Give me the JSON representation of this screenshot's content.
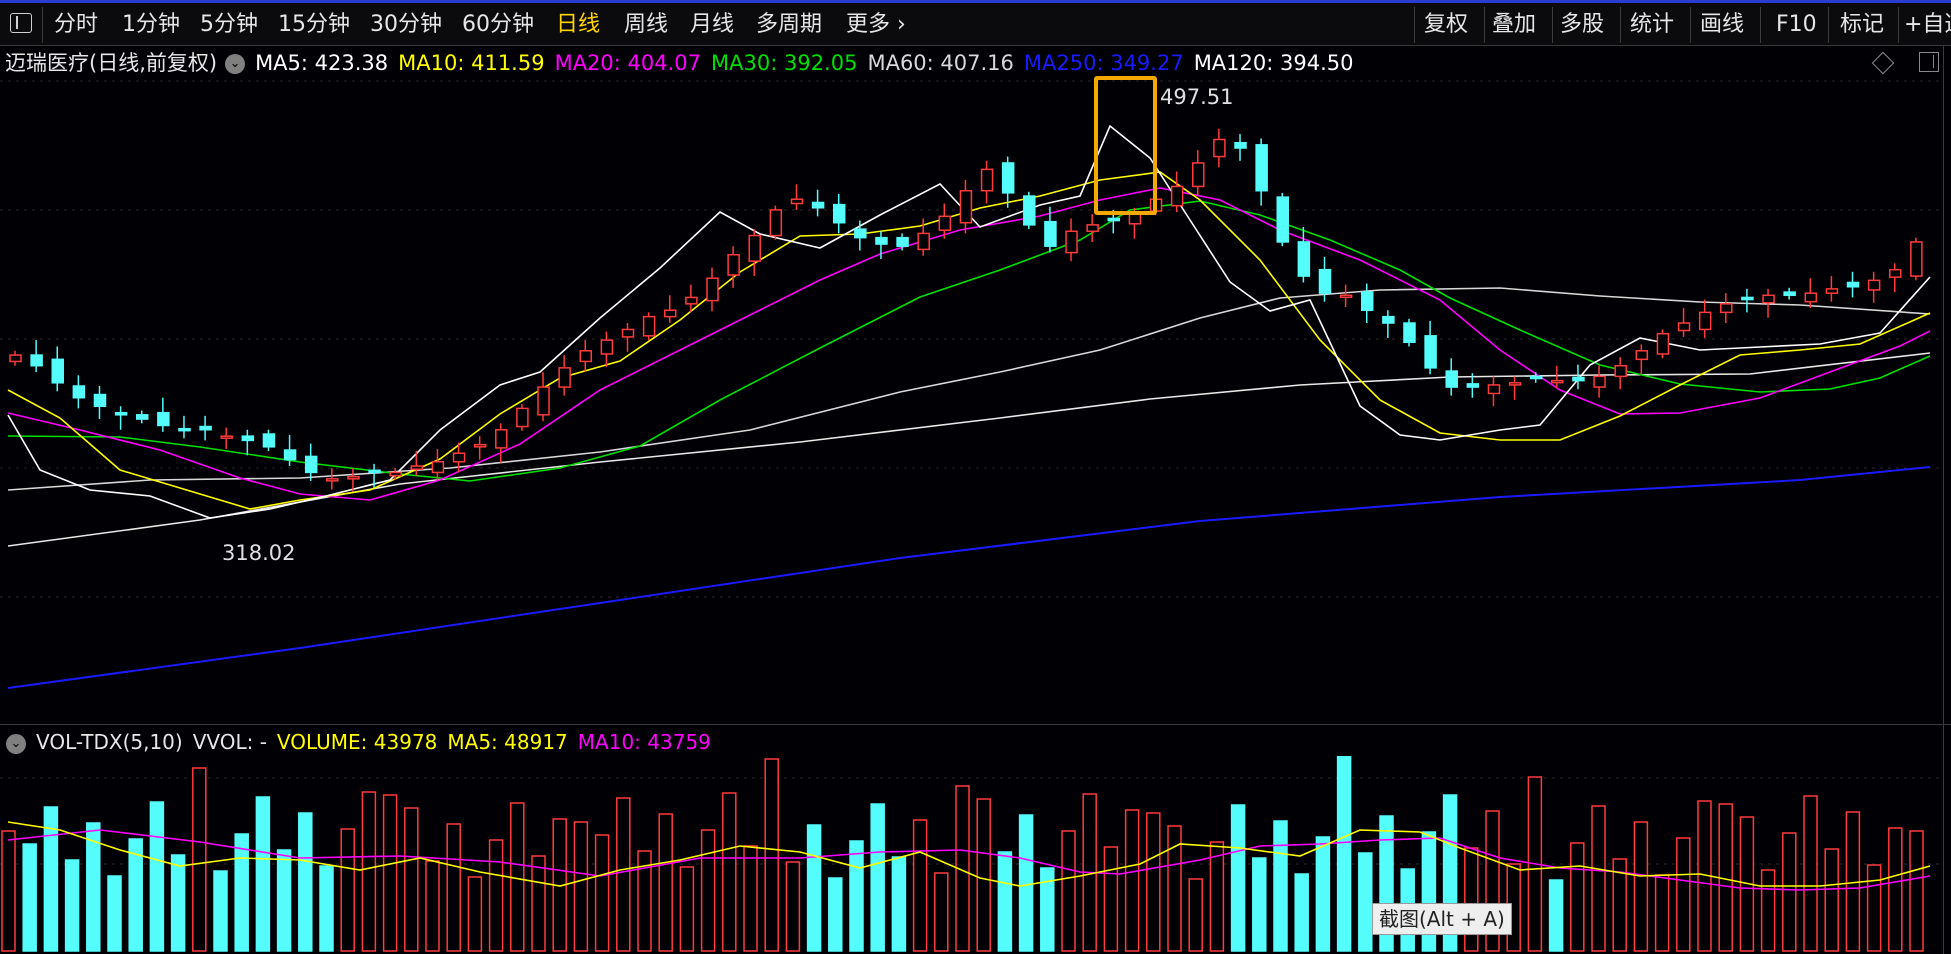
{
  "toolbar": {
    "tabs": [
      "分时",
      "1分钟",
      "5分钟",
      "15分钟",
      "30分钟",
      "60分钟",
      "日线",
      "周线",
      "月线",
      "多周期",
      "更多"
    ],
    "active_tab": "日线",
    "right_buttons": [
      "复权",
      "叠加",
      "多股",
      "统计",
      "画线",
      "F10",
      "标记",
      "+自选"
    ]
  },
  "price_legend": {
    "stock_title": "迈瑞医疗(日线,前复权)",
    "ma5": "MA5: 423.38",
    "ma10": "MA10: 411.59",
    "ma20": "MA20: 404.07",
    "ma30": "MA30: 392.05",
    "ma60": "MA60: 407.16",
    "ma250": "MA250: 349.27",
    "ma120": "MA120: 394.50"
  },
  "volume_legend": {
    "indicator": "VOL-TDX(5,10)",
    "vvol": "VVOL: -",
    "volume": "VOLUME: 43978",
    "ma5": "MA5: 48917",
    "ma10": "MA10: 43759"
  },
  "annotations": {
    "high": "497.51",
    "low": "318.02"
  },
  "screenshot_tip": "截图(Alt + A)",
  "colors": {
    "up": "#ff3b3b",
    "down": "#54fcfc",
    "ma5": "#ffffff",
    "ma10": "#ffff00",
    "ma20": "#ff00ff",
    "ma30": "#00e000",
    "ma60": "#d8d8d8",
    "ma250": "#1a1aff",
    "ma120": "#ffffff",
    "active_tab": "#ffd400",
    "highlight": "#f5a800"
  },
  "chart_data": {
    "type": "candlestick",
    "price_range": [
      296,
      512
    ],
    "series": [
      {
        "name": "MA5",
        "values": [
          385,
          380,
          372,
          365,
          361,
          357,
          355,
          352,
          350,
          350,
          347,
          345,
          342,
          336,
          330,
          327,
          328,
          330,
          330,
          333,
          335,
          339,
          343,
          350,
          360,
          370,
          379,
          387,
          392,
          397,
          403,
          406,
          412,
          421,
          432,
          441,
          453,
          458,
          454,
          447,
          440,
          437,
          436,
          442,
          450,
          462,
          472,
          461,
          446,
          436,
          443,
          446,
          448,
          451,
          458,
          464,
          475,
          486,
          482,
          462,
          438,
          422,
          414,
          413,
          406,
          400,
          391,
          379,
          370,
          370,
          371,
          372,
          374,
          373,
          373,
          375,
          380,
          387,
          395,
          400,
          405,
          409,
          411,
          413,
          413,
          414,
          416,
          417,
          420,
          425,
          438
        ]
      },
      {
        "name": "MA10",
        "values": [
          390,
          386,
          381,
          377,
          372,
          368,
          363,
          358,
          355,
          351,
          350,
          348,
          345,
          343,
          340,
          337,
          335,
          334,
          334,
          334,
          334,
          336,
          338,
          342,
          349,
          356,
          363,
          370,
          377,
          385,
          393,
          399,
          405,
          411,
          417,
          423,
          431,
          438,
          443,
          444,
          444,
          443,
          443,
          444,
          447,
          452,
          456,
          458,
          456,
          453,
          451,
          448,
          444,
          438,
          430,
          422,
          413,
          405,
          397,
          391,
          386,
          382,
          379,
          377,
          377,
          376,
          376,
          375,
          376,
          378,
          381,
          384,
          387,
          390,
          393,
          396,
          399,
          401,
          403,
          405,
          407,
          408,
          410,
          412,
          413,
          415
        ]
      }
    ],
    "high": 497.51,
    "low": 318.02
  }
}
